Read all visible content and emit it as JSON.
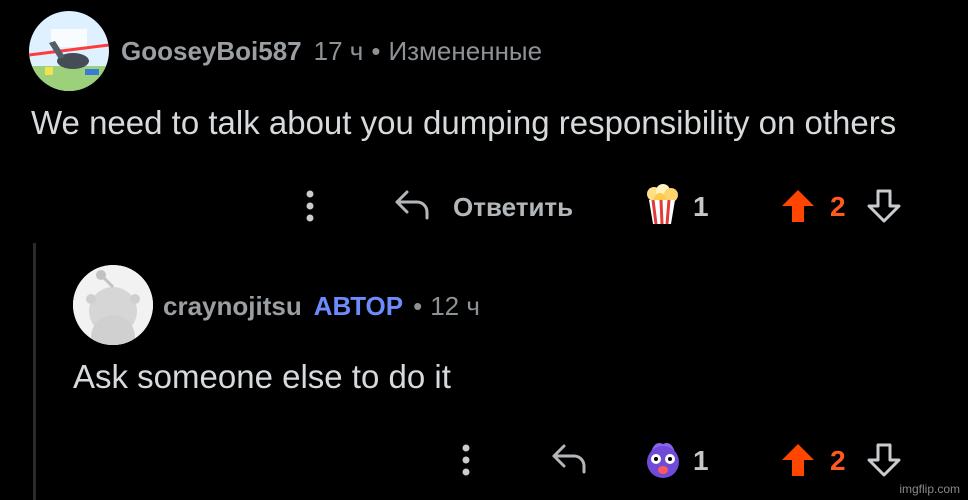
{
  "comments": [
    {
      "username": "GooseyBoi587",
      "time": "17 ч",
      "separator": "•",
      "edited": "Измененные",
      "text": "We need to talk about you dumping responsibility on others",
      "reply_label": "Ответить",
      "award_count": "1",
      "award_icon": "popcorn-award-icon",
      "vote_count": "2"
    },
    {
      "username": "craynojitsu",
      "op_badge": "АВТОР",
      "separator": "•",
      "time": "12 ч",
      "text": "Ask someone else to do it",
      "award_count": "1",
      "award_icon": "shocked-face-award-icon",
      "vote_count": "2"
    }
  ],
  "colors": {
    "background": "#000000",
    "upvote": "#ff4500",
    "op_badge": "#6d8bff",
    "text": "#d7dadc",
    "meta": "#8d9296"
  },
  "watermark": "imgflip.com"
}
